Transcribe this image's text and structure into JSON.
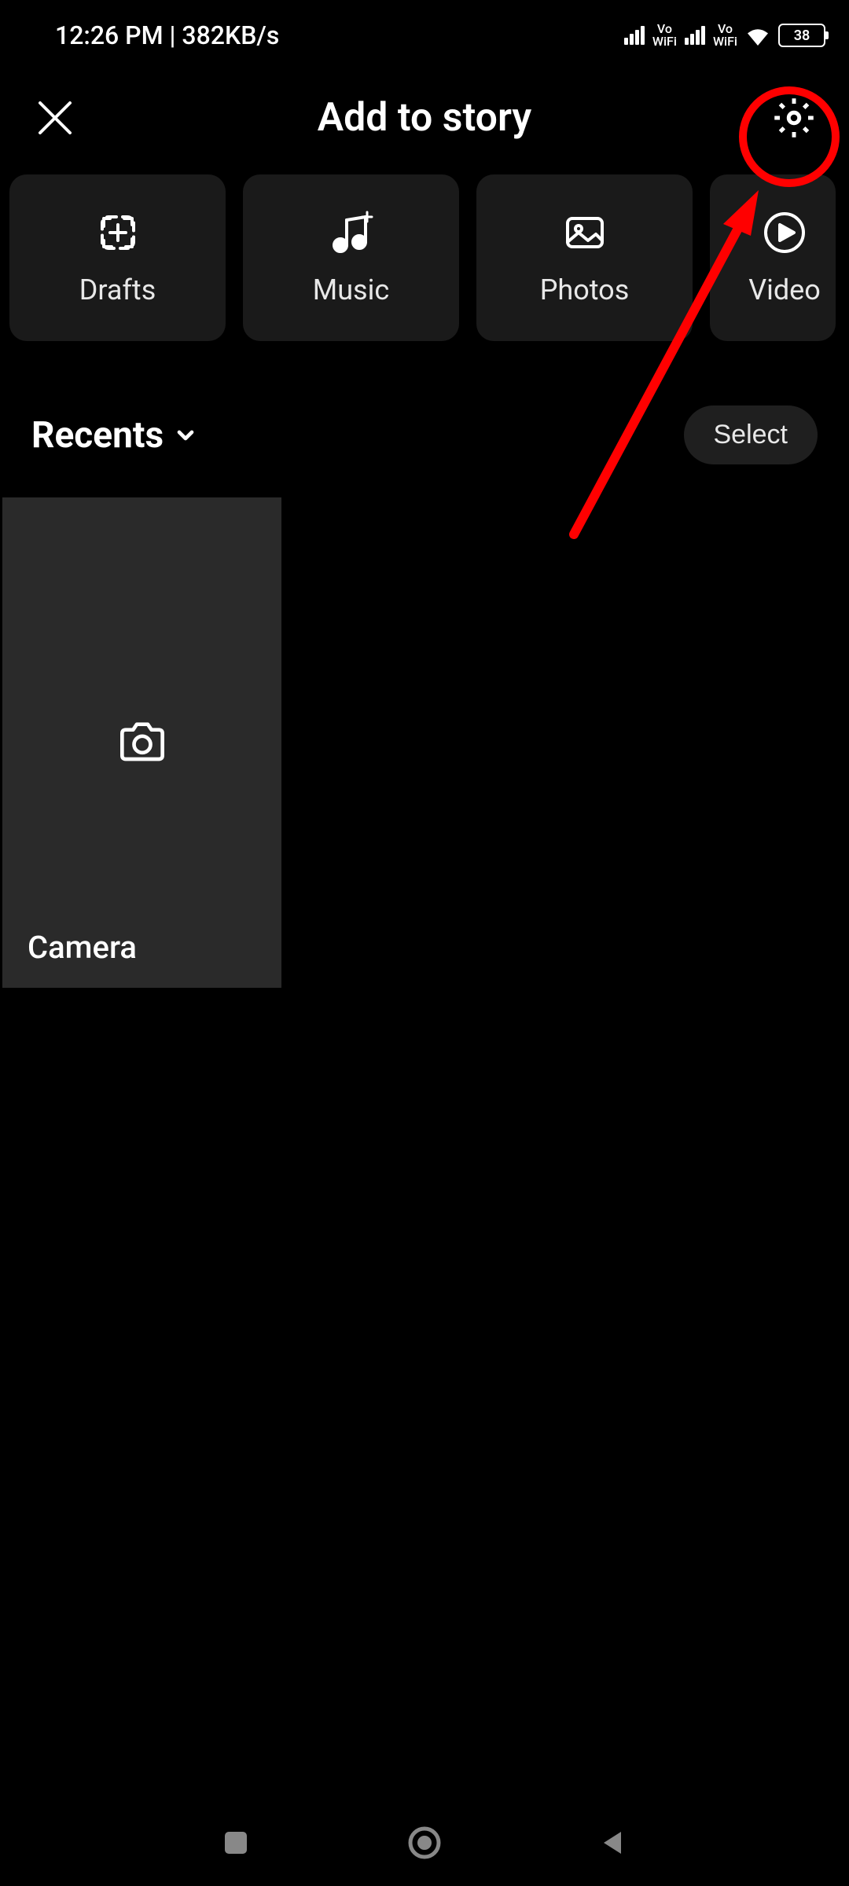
{
  "status_bar": {
    "time_text": "12:26 PM | 382KB/s",
    "vo_text": "Vo",
    "wifi_text": "WiFi",
    "battery_level": "38"
  },
  "header": {
    "title": "Add to story"
  },
  "tiles": [
    {
      "label": "Drafts",
      "icon": "drafts-icon"
    },
    {
      "label": "Music",
      "icon": "music-icon"
    },
    {
      "label": "Photos",
      "icon": "photos-icon"
    },
    {
      "label": "Video",
      "icon": "video-icon"
    }
  ],
  "recents": {
    "label": "Recents",
    "select_label": "Select"
  },
  "gallery": {
    "camera_label": "Camera"
  }
}
